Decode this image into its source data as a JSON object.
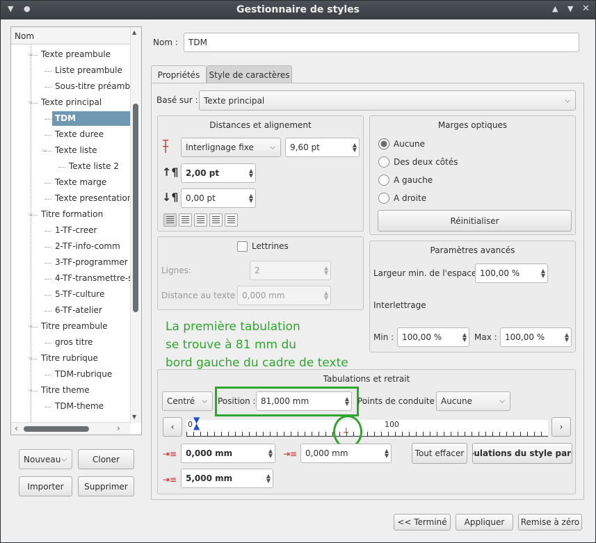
{
  "window": {
    "title": "Gestionnaire de styles"
  },
  "tree": {
    "header": "Nom",
    "items": [
      {
        "label": "Texte preambule",
        "level": 1,
        "twisty": "open"
      },
      {
        "label": "Liste preambule",
        "level": 2
      },
      {
        "label": "Sous-titre préamb",
        "level": 2
      },
      {
        "label": "Texte principal",
        "level": 1,
        "twisty": "open"
      },
      {
        "label": "TDM",
        "level": 2,
        "selected": true
      },
      {
        "label": "Texte duree",
        "level": 2
      },
      {
        "label": "Texte liste",
        "level": 2,
        "twisty": "open"
      },
      {
        "label": "Texte liste 2",
        "level": 3
      },
      {
        "label": "Texte marge",
        "level": 2
      },
      {
        "label": "Texte presentation",
        "level": 2
      },
      {
        "label": "Titre formation",
        "level": 1,
        "twisty": "open"
      },
      {
        "label": "1-TF-creer",
        "level": 2
      },
      {
        "label": "2-TF-info-comm",
        "level": 2
      },
      {
        "label": "3-TF-programmer",
        "level": 2
      },
      {
        "label": "4-TF-transmettre-s",
        "level": 2
      },
      {
        "label": "5-TF-culture",
        "level": 2
      },
      {
        "label": "6-TF-atelier",
        "level": 2
      },
      {
        "label": "Titre preambule",
        "level": 1,
        "twisty": "open"
      },
      {
        "label": "gros titre",
        "level": 2
      },
      {
        "label": "Titre rubrique",
        "level": 1,
        "twisty": "open"
      },
      {
        "label": "TDM-rubrique",
        "level": 2
      },
      {
        "label": "Titre theme",
        "level": 1,
        "twisty": "open"
      },
      {
        "label": "TDM-theme",
        "level": 2
      }
    ]
  },
  "left_buttons": {
    "new": "Nouveau",
    "clone": "Cloner",
    "import": "Importer",
    "delete": "Supprimer"
  },
  "name": {
    "label": "Nom :",
    "value": "TDM"
  },
  "tabs": {
    "properties": "Propriétés",
    "character": "Style de caractères"
  },
  "based_on": {
    "label": "Basé sur :",
    "value": "Texte principal"
  },
  "distances": {
    "title": "Distances et alignement",
    "line_spacing_mode": "Interlignage fixe",
    "line_spacing_value": "9,60 pt",
    "space_above": "2,00 pt",
    "space_below": "0,00 pt"
  },
  "optical_margins": {
    "title": "Marges optiques",
    "options": [
      "Aucune",
      "Des deux côtés",
      "A gauche",
      "A droite"
    ],
    "selected": "Aucune",
    "reset": "Réinitialiser"
  },
  "drop_caps": {
    "title": "Lettrines",
    "lines_label": "Lignes:",
    "lines_value": "2",
    "distance_label": "Distance au texte :",
    "distance_value": "0,000 mm"
  },
  "advanced": {
    "title": "Paramètres avancés",
    "min_space_label": "Largeur min. de l'espace:",
    "min_space_value": "100,00 %",
    "tracking_label": "Interlettrage",
    "min_label": "Min :",
    "min_value": "100,00 %",
    "max_label": "Max :",
    "max_value": "100,00 %"
  },
  "annotation": {
    "lines": [
      "La première tabulation",
      "se trouve à 81 mm du",
      "bord gauche du cadre de texte"
    ],
    "color": "#2fa52f"
  },
  "tabs_indent": {
    "title": "Tabulations et retrait",
    "alignment": "Centré",
    "position_label": "Position :",
    "position_value": "81,000 mm",
    "leader_label": "Points de conduite :",
    "leader_value": "Aucune",
    "ruler_labels": [
      "0",
      "100"
    ],
    "first_indent": "0,000 mm",
    "left_indent": "0,000 mm",
    "right_indent": "5,000 mm",
    "clear_all": "Tout effacer",
    "parent_tabs": "Tabulations du style parent"
  },
  "footer": {
    "done": "<< Terminé",
    "apply": "Appliquer",
    "reset": "Remise à zéro"
  }
}
